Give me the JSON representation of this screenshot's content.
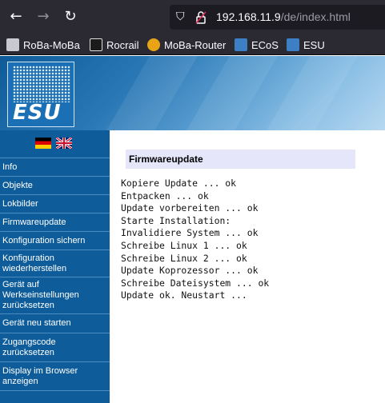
{
  "browser": {
    "url_host": "192.168.11.9",
    "url_path": "/de/index.html",
    "bookmarks": [
      {
        "label": "RoBa-MoBa",
        "icon": "folder-icon"
      },
      {
        "label": "Rocrail",
        "icon": "rocrail-icon"
      },
      {
        "label": "MoBa-Router",
        "icon": "moba-router-icon"
      },
      {
        "label": "ECoS",
        "icon": "esu-favicon-icon"
      },
      {
        "label": "ESU",
        "icon": "esu-favicon-icon"
      }
    ]
  },
  "logo": {
    "text": "ESU"
  },
  "sidebar": {
    "items": [
      {
        "label": "Info"
      },
      {
        "label": "Objekte"
      },
      {
        "label": "Lokbilder"
      },
      {
        "label": "Firmwareupdate"
      },
      {
        "label": "Konfiguration sichern"
      },
      {
        "label": "Konfiguration wiederherstellen"
      },
      {
        "label": "Gerät auf Werkseinstellungen zurücksetzen"
      },
      {
        "label": "Gerät neu starten"
      },
      {
        "label": "Zugangscode zurücksetzen"
      },
      {
        "label": "Display im Browser anzeigen"
      }
    ]
  },
  "main": {
    "title": "Firmwareupdate",
    "log": [
      "Kopiere Update ... ok",
      "Entpacken ... ok",
      "Update vorbereiten ... ok",
      "Starte Installation:",
      "Invalidiere System ... ok",
      "Schreibe Linux 1 ... ok",
      "Schreibe Linux 2 ... ok",
      "Update Koprozessor ... ok",
      "Schreibe Dateisystem ... ok",
      "Update ok. Neustart ..."
    ]
  },
  "colors": {
    "sidebar": "#0e5c99",
    "title_bg": "#e6e6fb",
    "browser_bg": "#2b2a33"
  }
}
